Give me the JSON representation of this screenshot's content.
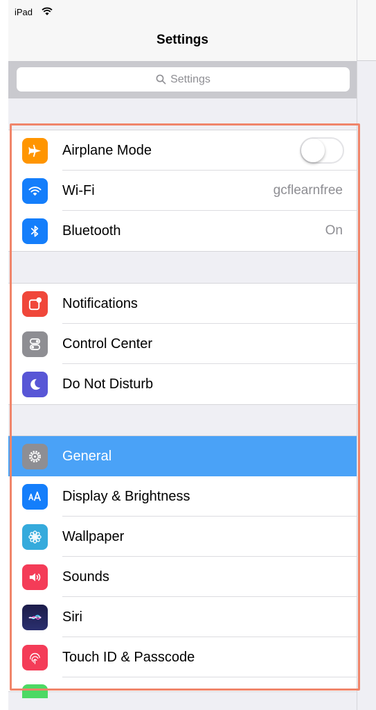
{
  "status_bar": {
    "device": "iPad",
    "icon": "wifi-icon"
  },
  "nav": {
    "title": "Settings"
  },
  "search": {
    "placeholder": "Settings",
    "icon": "search-icon"
  },
  "groups": [
    [
      {
        "label": "Airplane Mode",
        "icon": "airplane-icon",
        "color": "#ff9500",
        "accessory": "toggle",
        "toggle_on": false
      },
      {
        "label": "Wi-Fi",
        "icon": "wifi-icon",
        "color": "#147efb",
        "value": "gcflearnfree"
      },
      {
        "label": "Bluetooth",
        "icon": "bluetooth-icon",
        "color": "#147efb",
        "value": "On"
      }
    ],
    [
      {
        "label": "Notifications",
        "icon": "notifications-icon",
        "color": "#f0473a"
      },
      {
        "label": "Control Center",
        "icon": "control-center-icon",
        "color": "#8e8e93"
      },
      {
        "label": "Do Not Disturb",
        "icon": "moon-icon",
        "color": "#5856d6"
      }
    ],
    [
      {
        "label": "General",
        "icon": "gear-icon",
        "color": "#8e8e93",
        "selected": true
      },
      {
        "label": "Display & Brightness",
        "icon": "display-icon",
        "color": "#147efb"
      },
      {
        "label": "Wallpaper",
        "icon": "wallpaper-icon",
        "color": "#35aadc"
      },
      {
        "label": "Sounds",
        "icon": "sounds-icon",
        "color": "#f43c58"
      },
      {
        "label": "Siri",
        "icon": "siri-icon",
        "color": "#1c1c4a"
      },
      {
        "label": "Touch ID & Passcode",
        "icon": "fingerprint-icon",
        "color": "#f43c58"
      }
    ]
  ],
  "colors": {
    "highlight": "#f0856a",
    "selected_row": "#4aa2f7"
  }
}
